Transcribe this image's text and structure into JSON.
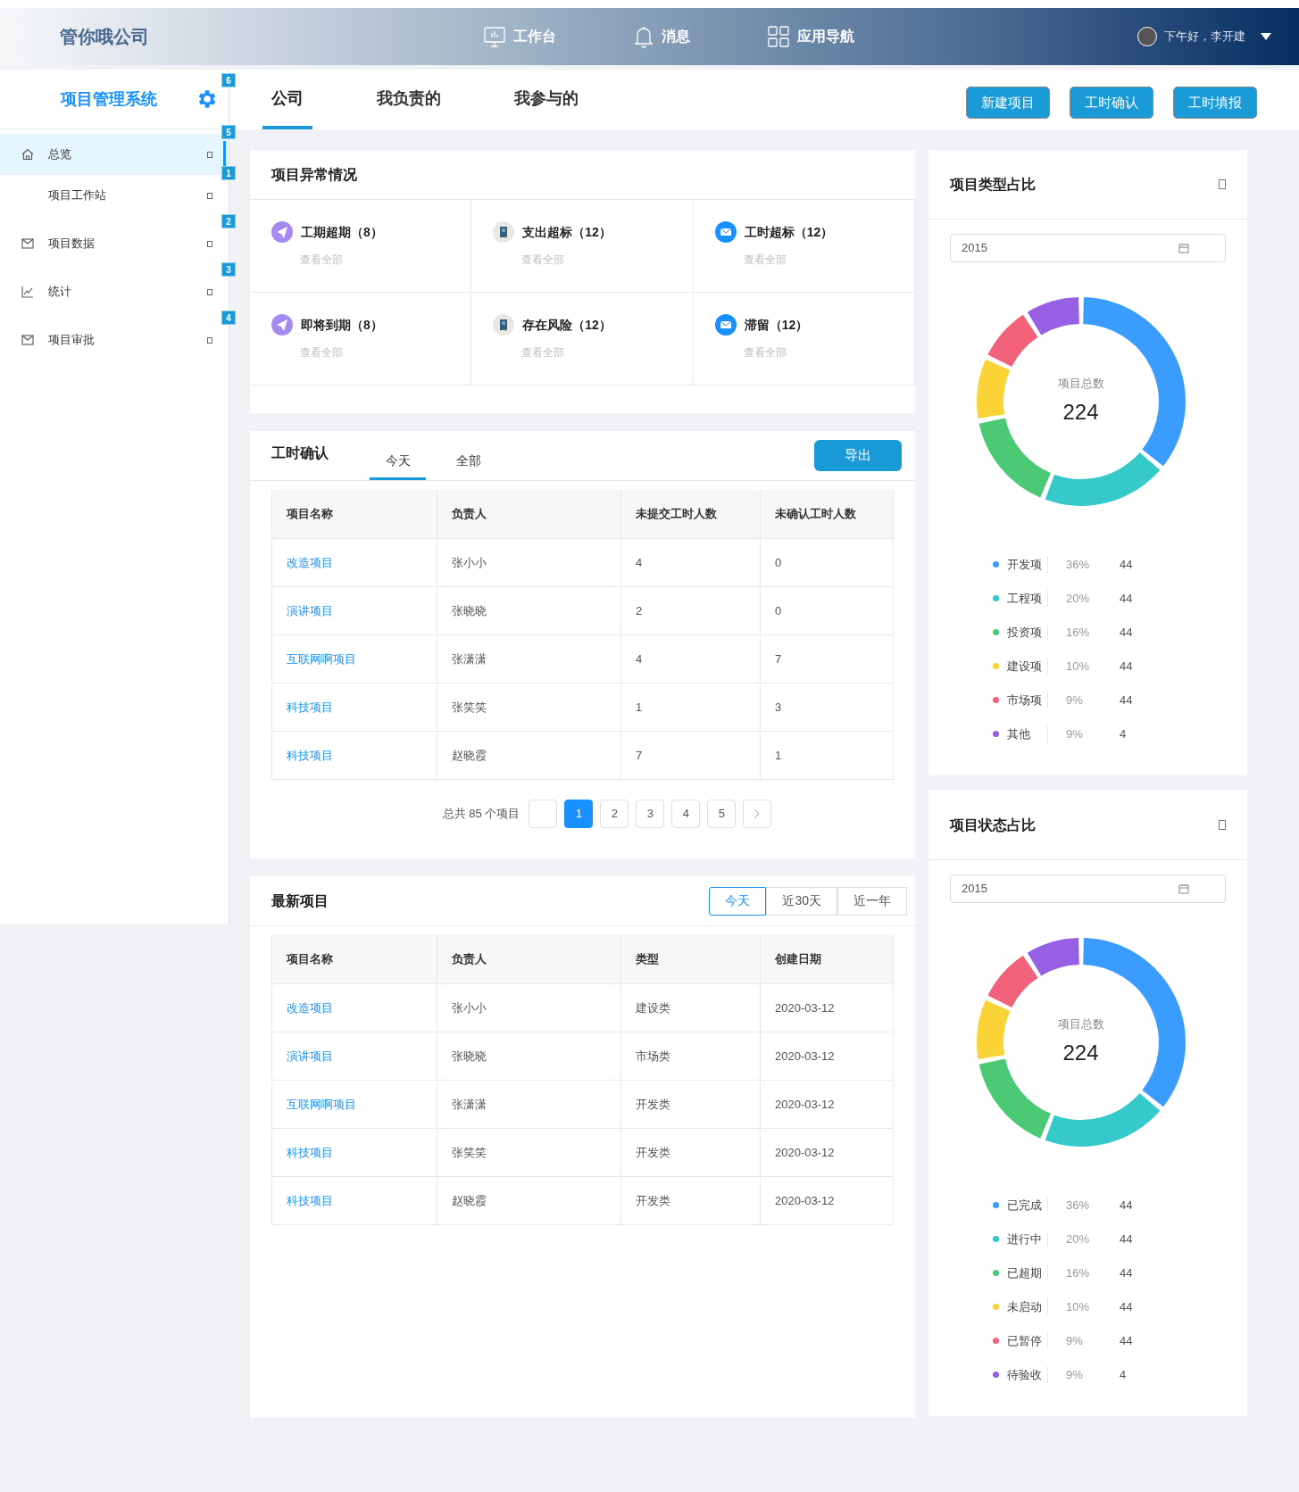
{
  "topbar": {
    "company": "管你哦公司",
    "nav": [
      {
        "label": "工作台",
        "kind": "monitor"
      },
      {
        "label": "消息",
        "kind": "bell"
      },
      {
        "label": "应用导航",
        "kind": "grid"
      }
    ],
    "greeting": "下午好，李开建"
  },
  "header": {
    "system": "项目管理系统",
    "badge": "6",
    "tabs": [
      {
        "label": "公司",
        "selected": true
      },
      {
        "label": "我负责的",
        "selected": false
      },
      {
        "label": "我参与的",
        "selected": false
      }
    ],
    "buttons": [
      "新建项目",
      "工时确认",
      "工时填报"
    ]
  },
  "sidebar": {
    "items": [
      {
        "label": "总览",
        "kind": "home",
        "selected": true,
        "badge": "5",
        "children": [
          {
            "label": "项目工作站",
            "selected": false,
            "badge": "1"
          }
        ]
      },
      {
        "label": "项目数据",
        "kind": "mail",
        "selected": false,
        "badge": "2"
      },
      {
        "label": "统计",
        "kind": "chart",
        "selected": false,
        "badge": "3"
      },
      {
        "label": "项目审批",
        "kind": "mail",
        "selected": false,
        "badge": "4"
      }
    ]
  },
  "anomalies": {
    "title": "项目异常情况",
    "items": [
      {
        "label": "工期超期（8）",
        "kind": "plane",
        "link": "查看全部"
      },
      {
        "label": "支出超标（12）",
        "kind": "book",
        "link": "查看全部"
      },
      {
        "label": "工时超标（12）",
        "kind": "mail",
        "link": "查看全部"
      },
      {
        "label": "即将到期（8）",
        "kind": "plane",
        "link": "查看全部"
      },
      {
        "label": "存在风险（12）",
        "kind": "book",
        "link": "查看全部"
      },
      {
        "label": "滞留（12）",
        "kind": "mail",
        "link": "查看全部"
      }
    ]
  },
  "hours": {
    "title": "工时确认",
    "tabs": [
      {
        "label": "今天",
        "selected": true
      },
      {
        "label": "全部",
        "selected": false
      }
    ],
    "export": "导出",
    "columns": [
      "项目名称",
      "负责人",
      "未提交工时人数",
      "未确认工时人数"
    ],
    "rows": [
      [
        "改造项目",
        "张小小",
        "4",
        "0"
      ],
      [
        "演讲项目",
        "张晓晓",
        "2",
        "0"
      ],
      [
        "互联网啊项目",
        "张潇潇",
        "4",
        "7"
      ],
      [
        "科技项目",
        "张笑笑",
        "1",
        "3"
      ],
      [
        "科技项目",
        "赵晓霞",
        "7",
        "1"
      ]
    ],
    "pagination": {
      "total": "总共 85 个项目",
      "pages": [
        {
          "label": "1",
          "selected": true
        },
        {
          "label": "2",
          "selected": false
        },
        {
          "label": "3",
          "selected": false
        },
        {
          "label": "4",
          "selected": false
        },
        {
          "label": "5",
          "selected": false
        }
      ]
    }
  },
  "latest": {
    "title": "最新项目",
    "ranges": [
      {
        "label": "今天",
        "selected": true
      },
      {
        "label": "近30天",
        "selected": false
      },
      {
        "label": "近一年",
        "selected": false
      }
    ],
    "columns": [
      "项目名称",
      "负责人",
      "类型",
      "创建日期"
    ],
    "rows": [
      [
        "改造项目",
        "张小小",
        "建设类",
        "2020-03-12"
      ],
      [
        "演讲项目",
        "张晓晓",
        "市场类",
        "2020-03-12"
      ],
      [
        "互联网啊项目",
        "张潇潇",
        "开发类",
        "2020-03-12"
      ],
      [
        "科技项目",
        "张笑笑",
        "开发类",
        "2020-03-12"
      ],
      [
        "科技项目",
        "赵晓霞",
        "开发类",
        "2020-03-12"
      ]
    ]
  },
  "charts": [
    {
      "title": "项目类型占比",
      "year": "2015",
      "center_label": "项目总数",
      "center_value": "224",
      "chart_data": {
        "type": "donut",
        "categories": [
          "开发项",
          "工程项",
          "投资项",
          "建设项",
          "市场项",
          "其他"
        ],
        "values": [
          36,
          20,
          16,
          10,
          9,
          9
        ]
      },
      "legend": [
        {
          "color": "#3a9dfd",
          "percent": "36%",
          "count": "44"
        },
        {
          "color": "#36c9c9",
          "percent": "20%",
          "count": "44"
        },
        {
          "color": "#4bc974",
          "percent": "16%",
          "count": "44"
        },
        {
          "color": "#fad337",
          "percent": "10%",
          "count": "44"
        },
        {
          "color": "#f2637b",
          "percent": "9%",
          "count": "44"
        },
        {
          "color": "#975fe4",
          "percent": "9%",
          "count": "4"
        }
      ]
    },
    {
      "title": "项目状态占比",
      "year": "2015",
      "center_label": "项目总数",
      "center_value": "224",
      "chart_data": {
        "type": "donut",
        "categories": [
          "已完成",
          "进行中",
          "已超期",
          "未启动",
          "已暂停",
          "待验收"
        ],
        "values": [
          36,
          20,
          16,
          10,
          9,
          9
        ]
      },
      "legend": [
        {
          "color": "#3a9dfd",
          "percent": "36%",
          "count": "44"
        },
        {
          "color": "#36c9c9",
          "percent": "20%",
          "count": "44"
        },
        {
          "color": "#4bc974",
          "percent": "16%",
          "count": "44"
        },
        {
          "color": "#fad337",
          "percent": "10%",
          "count": "44"
        },
        {
          "color": "#f2637b",
          "percent": "9%",
          "count": "44"
        },
        {
          "color": "#975fe4",
          "percent": "9%",
          "count": "4"
        }
      ]
    }
  ]
}
